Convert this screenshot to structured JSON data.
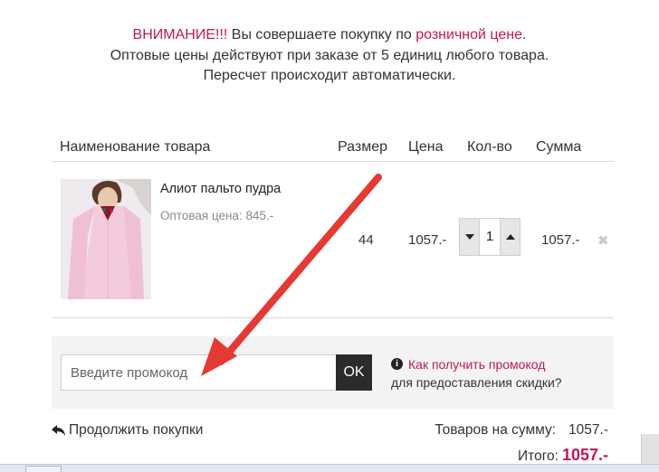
{
  "notice": {
    "attention": "ВНИМАНИЕ!!!",
    "line1_mid": " Вы совершаете покупку по ",
    "retail_price": "розничной цене",
    "line1_end": ".",
    "line2": "Оптовые цены действуют при заказе от 5 единиц любого товара.",
    "line3": "Пересчет происходит автоматически."
  },
  "table": {
    "headers": {
      "name": "Наименование товара",
      "size": "Размер",
      "price": "Цена",
      "qty": "Кол-во",
      "sum": "Сумма"
    }
  },
  "item": {
    "name": "Алиот пальто пудра",
    "wholesale": "Оптовая цена: 845.-",
    "size": "44",
    "price": "1057.-",
    "qty": "1",
    "sum": "1057.-",
    "remove_icon": "close-icon"
  },
  "promo": {
    "placeholder": "Введите промокод",
    "ok_label": "OK",
    "info_icon": "i",
    "link": "Как получить промокод",
    "subtext": "для предоставления скидки?"
  },
  "footer": {
    "continue_label": "Продолжить покупки",
    "subtotal_label": "Товаров на сумму:",
    "subtotal_value": "1057.-",
    "total_label": "Итого:",
    "total_value": "1057.-"
  },
  "colors": {
    "accent": "#c2185b",
    "annotation_arrow": "#e53935",
    "ok_button": "#2b2b2b"
  }
}
